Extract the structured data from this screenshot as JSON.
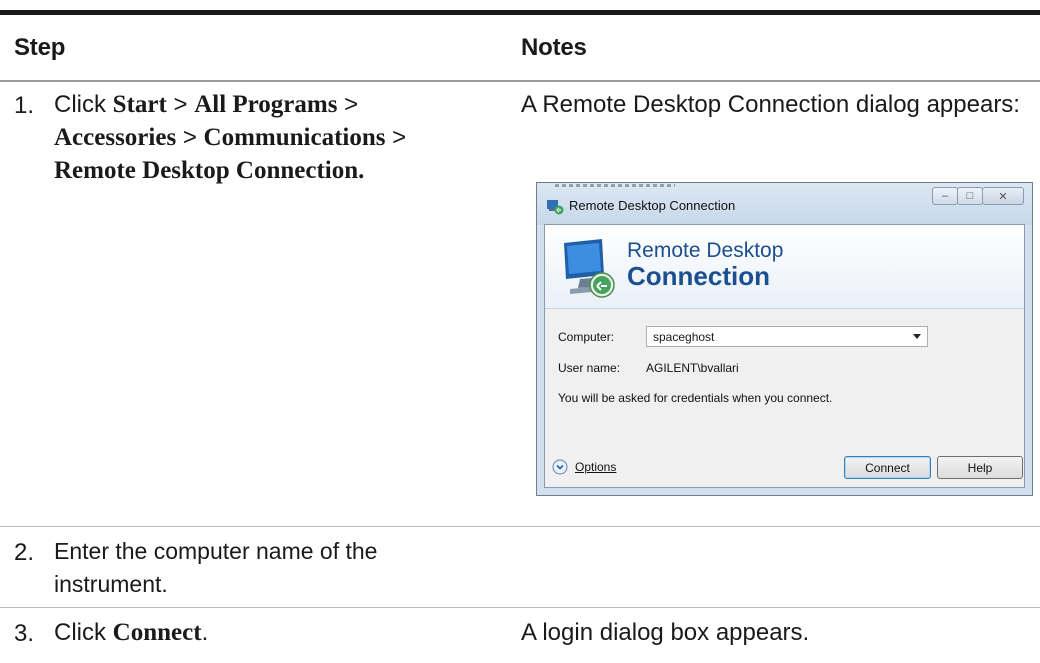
{
  "table": {
    "header": {
      "step": "Step",
      "notes": "Notes"
    },
    "rows": [
      {
        "num": "1.",
        "step_parts": [
          "Click ",
          "Start",
          " > ",
          "All Programs",
          " > ",
          "Accessories",
          " > ",
          "Communications",
          " > ",
          "Remote Desktop Connection."
        ],
        "note": "A Remote Desktop Connection dialog appears:"
      },
      {
        "num": "2.",
        "step_text": "Enter the computer name of the instrument.",
        "note": ""
      },
      {
        "num": "3.",
        "step_parts": [
          "Click ",
          "Connect",
          "."
        ],
        "note": "A login dialog box appears."
      }
    ]
  },
  "dialog": {
    "title": "Remote Desktop Connection",
    "banner_line1": "Remote Desktop",
    "banner_line2": "Connection",
    "computer_label": "Computer:",
    "computer_value": "spaceghost",
    "username_label": "User name:",
    "username_value": "AGILENT\\bvallari",
    "credentials_text": "You will be asked for credentials when you connect.",
    "options_label": "Options",
    "connect_label": "Connect",
    "help_label": "Help",
    "icons": [
      "remote-desktop-icon",
      "minimize-icon",
      "maximize-icon",
      "close-icon",
      "expand-options-icon",
      "dropdown-arrow-icon"
    ]
  }
}
